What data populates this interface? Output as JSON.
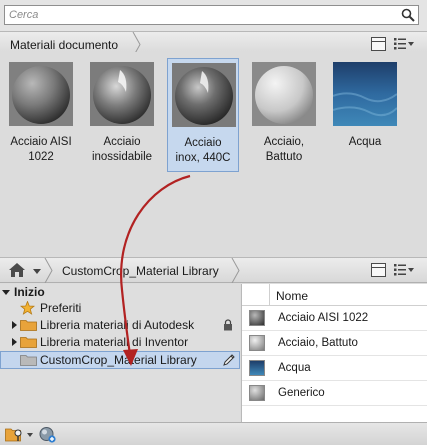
{
  "search": {
    "placeholder": "Cerca"
  },
  "document_bar": {
    "title": "Materiali documento"
  },
  "materials": [
    {
      "label_line1": "Acciaio AISI",
      "label_line2": "1022",
      "selected": false,
      "style": "aisi"
    },
    {
      "label_line1": "Acciaio",
      "label_line2": "inossidabile",
      "selected": false,
      "style": "inox"
    },
    {
      "label_line1": "Acciaio",
      "label_line2": "inox, 440C",
      "selected": true,
      "style": "inox440"
    },
    {
      "label_line1": "Acciaio,",
      "label_line2": "Battuto",
      "selected": false,
      "style": "battuto"
    },
    {
      "label_line1": "Acqua",
      "label_line2": "",
      "selected": false,
      "style": "acqua"
    }
  ],
  "library_bar": {
    "current": "CustomCrop_Material Library"
  },
  "tree": {
    "root": "Inizio",
    "items": [
      {
        "label": "Preferiti",
        "icon": "star-icon"
      },
      {
        "label": "Libreria materiali di Autodesk",
        "icon": "folder-icon",
        "locked": true
      },
      {
        "label": "Libreria materiali di Inventor",
        "icon": "folder-icon"
      },
      {
        "label": "CustomCrop_Material Library",
        "icon": "folder-icon",
        "selected": true,
        "editable": true
      }
    ]
  },
  "list": {
    "column_header": "Nome",
    "rows": [
      {
        "name": "Acciaio AISI 1022",
        "style": "aisi"
      },
      {
        "name": "Acciaio, Battuto",
        "style": "battuto"
      },
      {
        "name": "Acqua",
        "style": "acqua"
      },
      {
        "name": "Generico",
        "style": "generico"
      }
    ]
  },
  "colors": {
    "selection_bg": "#c6d8ee",
    "selection_border": "#7ea2d0",
    "drag_arrow": "#b22222",
    "folder": "#e8a33a"
  }
}
